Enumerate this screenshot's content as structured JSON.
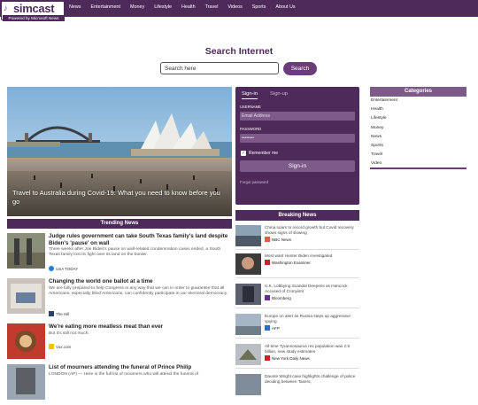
{
  "header": {
    "logo_text": "simcast",
    "logo_powered": "Powered by Microsoft News",
    "nav": [
      "News",
      "Entertainment",
      "Money",
      "Lifestyle",
      "Health",
      "Travel",
      "Videos",
      "Sports",
      "About Us"
    ]
  },
  "search": {
    "title": "Search Internet",
    "placeholder": "Search here",
    "button": "Search"
  },
  "hero": {
    "caption": "Travel to Australia during Covid-19: What you need to know before you go"
  },
  "trending": {
    "heading": "Trending News",
    "items": [
      {
        "title": "Judge rules government can take South Texas family's land despite Biden's 'pause' on wall",
        "desc": "Three weeks after Joe Biden's pause on wall-related condemnation cases ended, a South Texas family lost its fight over its land on the border.",
        "source": "USA TODAY"
      },
      {
        "title": "Changing the world one ballot at a time",
        "desc": "We are fully prepared to help Congress in any way that we can in order to guarantee that all Americans, especially blind Americans, can confidently participate in our electoral democracy.",
        "source": "The Hill"
      },
      {
        "title": "We're eating more meatless meat than ever",
        "desc": "But it's still not much.",
        "source": "Vox.com"
      },
      {
        "title": "List of mourners attending the funeral of Prince Philip",
        "desc": "LONDON (AP) — Here is the full list of mourners who will attend the funeral of",
        "source": ""
      }
    ]
  },
  "login": {
    "tab_signin": "Sign-in",
    "tab_signup": "Sign-up",
    "username_label": "USERNAME",
    "username_placeholder": "Email Address",
    "password_label": "PASSWORD",
    "password_value": "••••••••",
    "remember": "Remember me",
    "signin_button": "Sign-in",
    "forgot": "Forgot password"
  },
  "breaking": {
    "heading": "Breaking News",
    "items": [
      {
        "title": "China soars to record growth but Covid recovery shows signs of slowing",
        "source": "NBC News"
      },
      {
        "title": "Most want Hunter Biden investigated",
        "source": "Washington Examiner"
      },
      {
        "title": "U.K. Lobbying Scandal Deepens as Hancock Accused of Cronyism",
        "source": "Bloomberg"
      },
      {
        "title": "Europe on alert as Russia steps up aggressive spying",
        "source": "AFP"
      },
      {
        "title": "All-time Tyrannosaurus rex population was 2.5 billion, new study estimates",
        "source": "New York Daily News"
      },
      {
        "title": "Daunte Wright case highlights challenge of police deciding between Tasers,",
        "source": ""
      }
    ]
  },
  "categories": {
    "heading": "Categories",
    "items": [
      "Entertainment",
      "Health",
      "Lifestyle",
      "Money",
      "News",
      "Sports",
      "Travel",
      "Video"
    ]
  },
  "colors": {
    "brand": "#4e2a5a",
    "accent": "#6b3b7a"
  }
}
